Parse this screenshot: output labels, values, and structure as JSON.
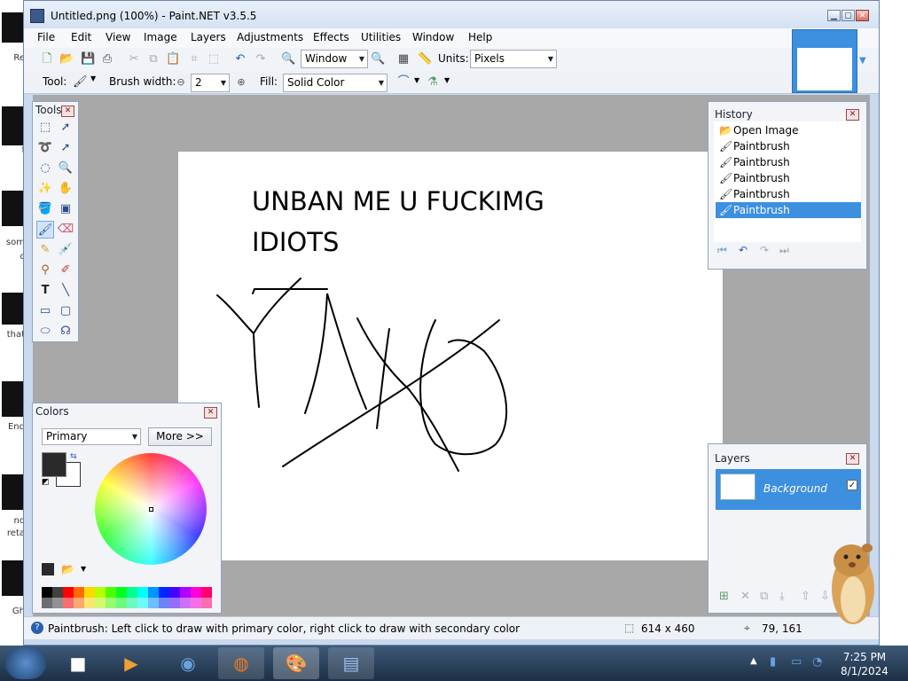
{
  "window": {
    "title": "Untitled.png (100%) - Paint.NET v3.5.5"
  },
  "menu": [
    "File",
    "Edit",
    "View",
    "Image",
    "Layers",
    "Adjustments",
    "Effects",
    "Utilities",
    "Window",
    "Help"
  ],
  "toolbar1": {
    "zoom_value": "Window",
    "units_label": "Units:",
    "units_value": "Pixels"
  },
  "toolbar2": {
    "tool_label": "Tool:",
    "brush_width_label": "Brush width:",
    "brush_width_value": "2",
    "fill_label": "Fill:",
    "fill_value": "Solid Color"
  },
  "tools_panel": {
    "title": "Tools",
    "tools": [
      "rectangle-select",
      "move-selection",
      "lasso-select",
      "move-selected",
      "ellipse-select",
      "zoom",
      "magic-wand",
      "pan",
      "paint-bucket",
      "gradient",
      "paintbrush",
      "eraser",
      "pencil",
      "color-picker",
      "clone-stamp",
      "recolor",
      "text",
      "line-curve",
      "rectangle",
      "rounded-rectangle",
      "ellipse",
      "freeform-shape"
    ]
  },
  "history_panel": {
    "title": "History",
    "items": [
      {
        "label": "Open Image",
        "icon": "folder-icon"
      },
      {
        "label": "Paintbrush",
        "icon": "paintbrush-icon"
      },
      {
        "label": "Paintbrush",
        "icon": "paintbrush-icon"
      },
      {
        "label": "Paintbrush",
        "icon": "paintbrush-icon"
      },
      {
        "label": "Paintbrush",
        "icon": "paintbrush-icon"
      },
      {
        "label": "Paintbrush",
        "icon": "paintbrush-icon",
        "selected": true
      }
    ]
  },
  "colors_panel": {
    "title": "Colors",
    "mode_value": "Primary",
    "more_label": "More >>",
    "primary_color": "#2a2a2a",
    "secondary_color": "#ffffff",
    "palette": [
      "#000000",
      "#404040",
      "#ff0000",
      "#ff6a00",
      "#ffd800",
      "#b6ff00",
      "#4cff00",
      "#00ff21",
      "#00ff90",
      "#00ffff",
      "#0094ff",
      "#0026ff",
      "#4800ff",
      "#b200ff",
      "#ff00dc",
      "#ff006e"
    ]
  },
  "layers_panel": {
    "title": "Layers",
    "layers": [
      {
        "name": "Background",
        "visible": true
      }
    ]
  },
  "canvas": {
    "text_line1": "UNBAN ME U FUCKIMG",
    "text_line2": "IDIOTS"
  },
  "statusbar": {
    "hint": "Paintbrush: Left click to draw with primary color, right click to draw with secondary color",
    "image_size": "614 x 460",
    "cursor_pos": "79, 161"
  },
  "taskbar": {
    "time": "7:25 PM",
    "date": "8/1/2024"
  },
  "desktop_labels": [
    "Re",
    "f",
    "som",
    "c",
    "that",
    "End",
    "no",
    "reta",
    "Gh"
  ]
}
